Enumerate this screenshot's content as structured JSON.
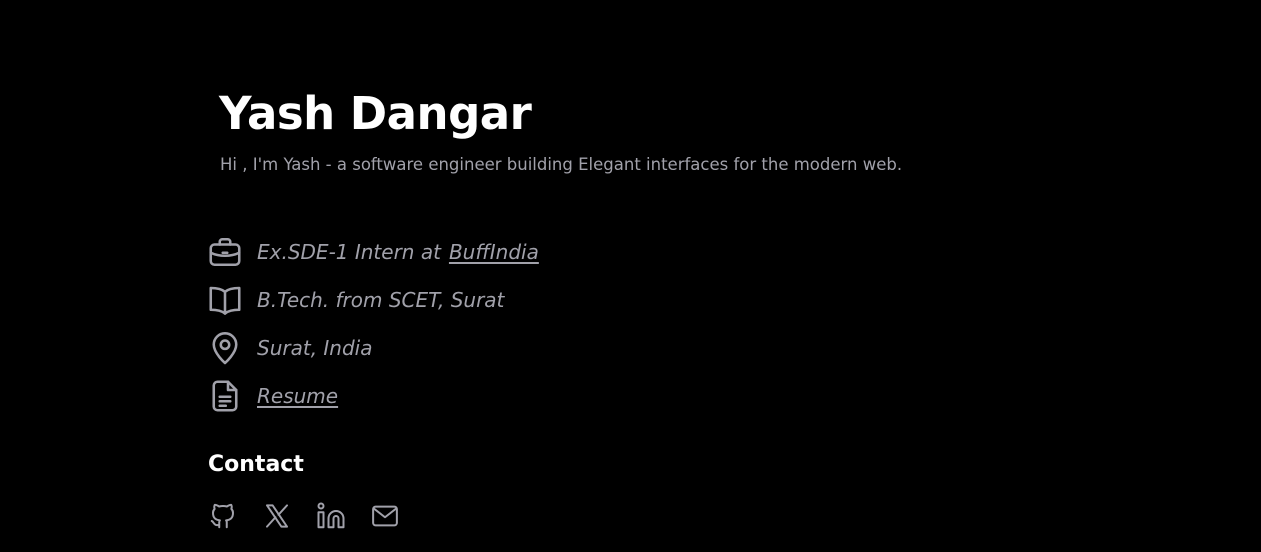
{
  "profile": {
    "name": "Yash Dangar",
    "tagline": "Hi , I'm Yash - a software engineer building Elegant interfaces for the modern web."
  },
  "info": {
    "experience_prefix": "Ex.SDE-1 Intern at",
    "experience_company": "BuffIndia",
    "education": "B.Tech. from SCET, Surat",
    "location": "Surat, India",
    "resume_label": "Resume"
  },
  "contact": {
    "heading": "Contact",
    "links": [
      {
        "icon": "github-icon"
      },
      {
        "icon": "x-twitter-icon"
      },
      {
        "icon": "linkedin-icon"
      },
      {
        "icon": "mail-icon"
      }
    ]
  },
  "colors": {
    "background": "#000000",
    "heading": "#ffffff",
    "muted_text": "#a1a1aa"
  }
}
